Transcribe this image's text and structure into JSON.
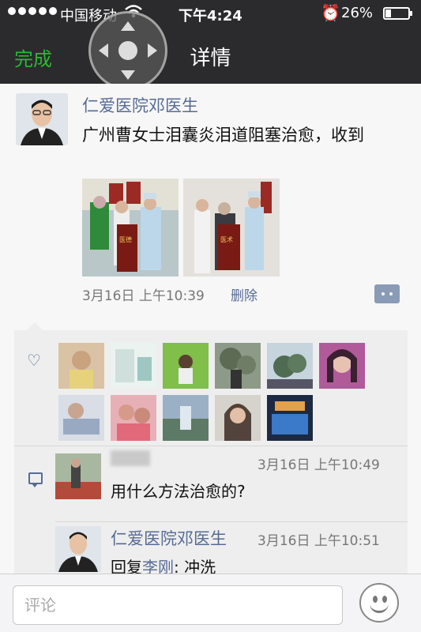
{
  "status_bar": {
    "carrier": "中国移动",
    "time": "下午4:24",
    "battery_percent_text": "26%",
    "battery_level": 0.26
  },
  "nav": {
    "done_label": "完成",
    "title": "详情"
  },
  "post": {
    "author": "仁爱医院邓医生",
    "text": "广州曹女士泪囊炎泪道阻塞治愈，收到",
    "timestamp": "3月16日 上午10:39",
    "delete_label": "删除"
  },
  "comments": [
    {
      "author": "",
      "time": "3月16日 上午10:49",
      "text": "用什么方法治愈的?"
    },
    {
      "author": "仁爱医院邓医生",
      "time": "3月16日 上午10:51",
      "reply_prefix": "回复",
      "reply_to": "李刚",
      "reply_sep": ":",
      "text": " 冲洗"
    }
  ],
  "composer": {
    "placeholder": "评论"
  },
  "colors": {
    "link": "#576b95",
    "done": "#2aba2f",
    "nav_bg": "#2b2b2d"
  }
}
